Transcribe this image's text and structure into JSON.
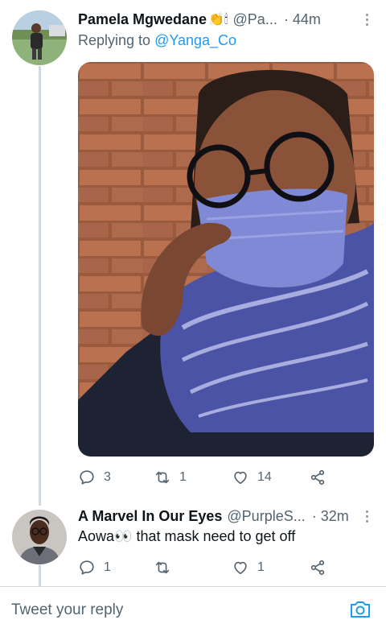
{
  "tweet1": {
    "author_name": "Pamela Mgwedane",
    "name_emoji": "👏🕯",
    "handle": "@Pa...",
    "time": "· 44m",
    "reply_prefix": "Replying to ",
    "reply_mention": "@Yanga_Co",
    "replies": "3",
    "retweets": "1",
    "likes": "14"
  },
  "tweet2": {
    "author_name": "A Marvel In Our Eyes",
    "handle": "@PurpleS...",
    "time": "· 32m",
    "text": "Aowa👀 that mask need to get off",
    "replies": "1",
    "retweets": "",
    "likes": "1"
  },
  "composer": {
    "placeholder": "Tweet your reply"
  },
  "icons": [
    "more-icon",
    "reply-icon",
    "retweet-icon",
    "like-icon",
    "share-icon",
    "camera-icon"
  ],
  "colors": {
    "link": "#1d9bf0",
    "muted": "#536471",
    "thread": "#cfd9de"
  }
}
